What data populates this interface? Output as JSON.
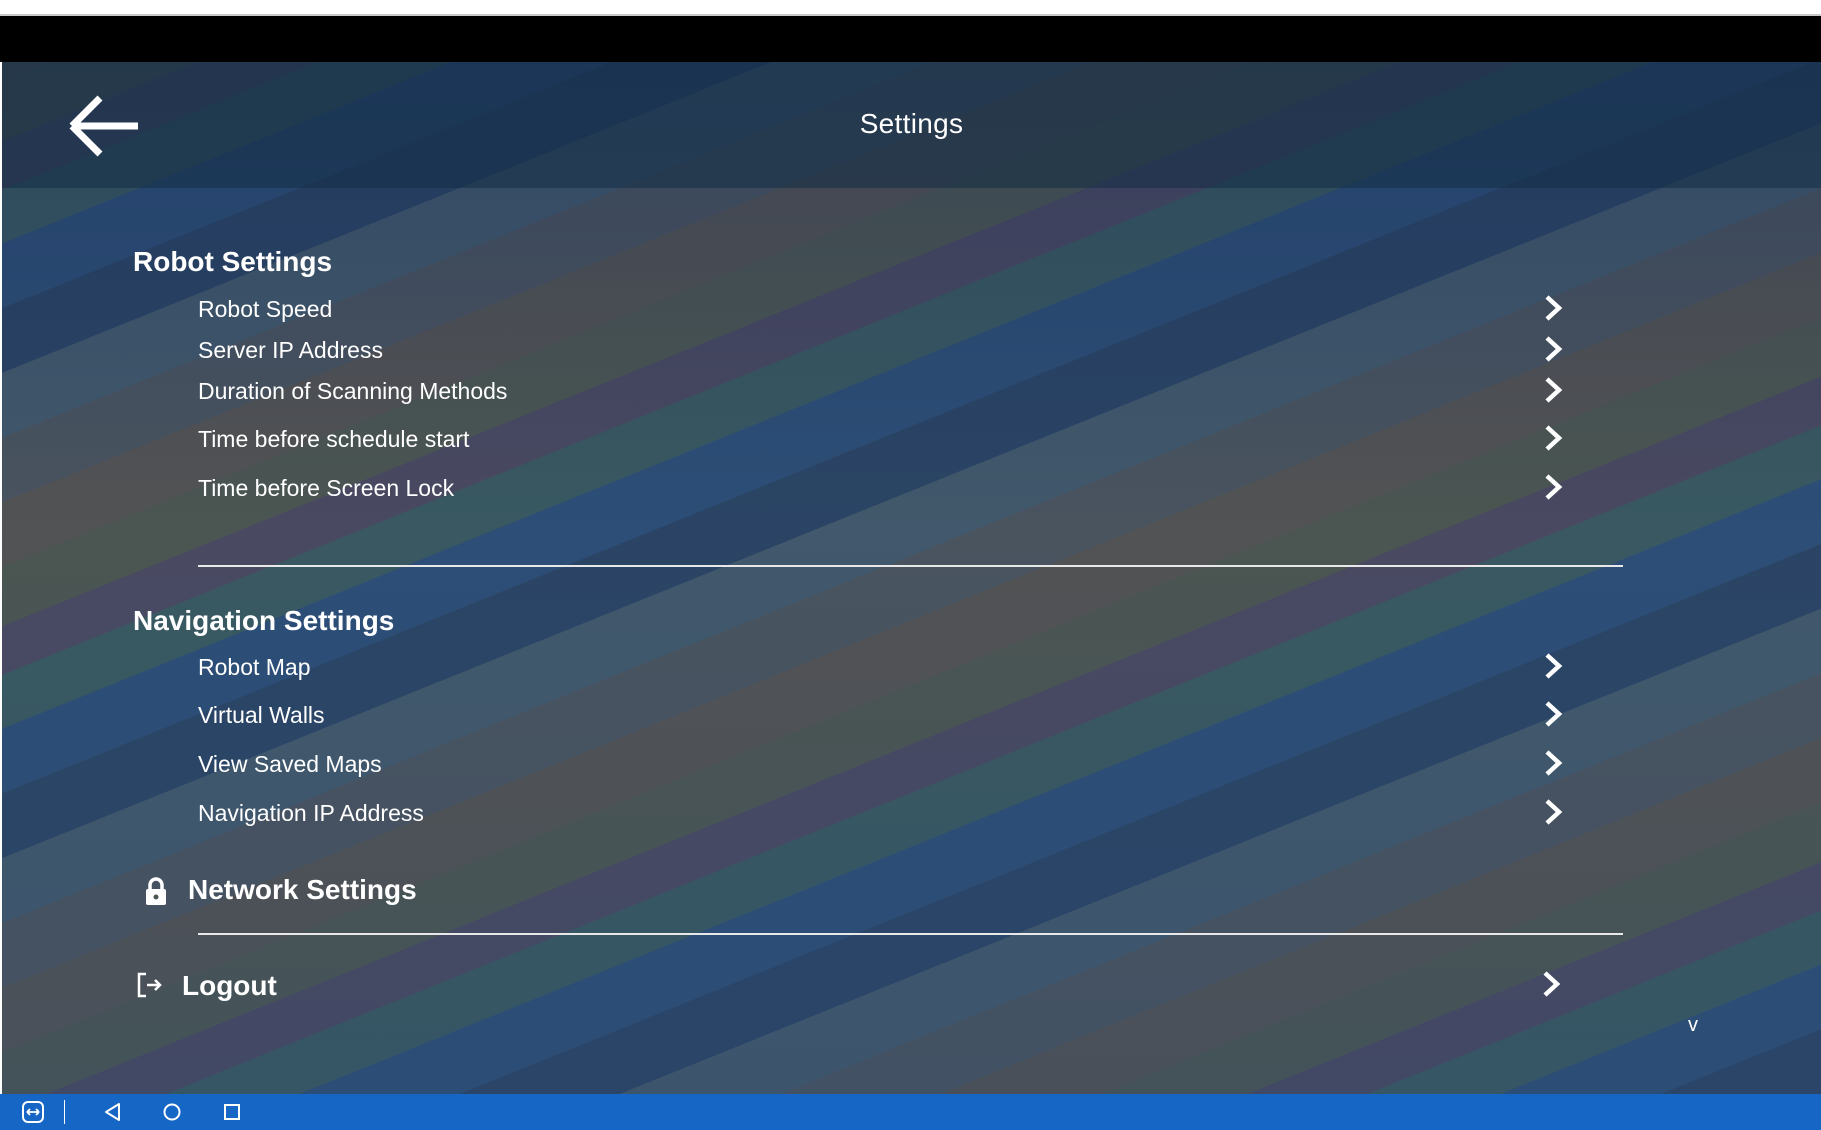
{
  "header": {
    "title": "Settings",
    "back_icon": "arrow-left-icon"
  },
  "sections": [
    {
      "title": "Robot Settings",
      "items": [
        {
          "label": "Robot Speed"
        },
        {
          "label": "Server IP Address"
        },
        {
          "label": "Duration of Scanning Methods"
        },
        {
          "label": "Time before schedule start"
        },
        {
          "label": "Time before Screen Lock"
        }
      ]
    },
    {
      "title": "Navigation Settings",
      "items": [
        {
          "label": "Robot Map"
        },
        {
          "label": "Virtual Walls"
        },
        {
          "label": "View Saved Maps"
        },
        {
          "label": "Navigation IP Address"
        }
      ]
    }
  ],
  "network": {
    "label": "Network Settings",
    "icon": "lock-icon"
  },
  "logout": {
    "label": "Logout",
    "icon": "logout-icon"
  },
  "version_label": "v",
  "system_nav": {
    "buttons": [
      "back-triangle-icon",
      "home-circle-icon",
      "recents-square-icon"
    ],
    "app_icon": "teamviewer-icon"
  },
  "colors": {
    "nav_bar": "#1666c6",
    "text": "#ffffff",
    "divider": "#e8e8e8"
  }
}
